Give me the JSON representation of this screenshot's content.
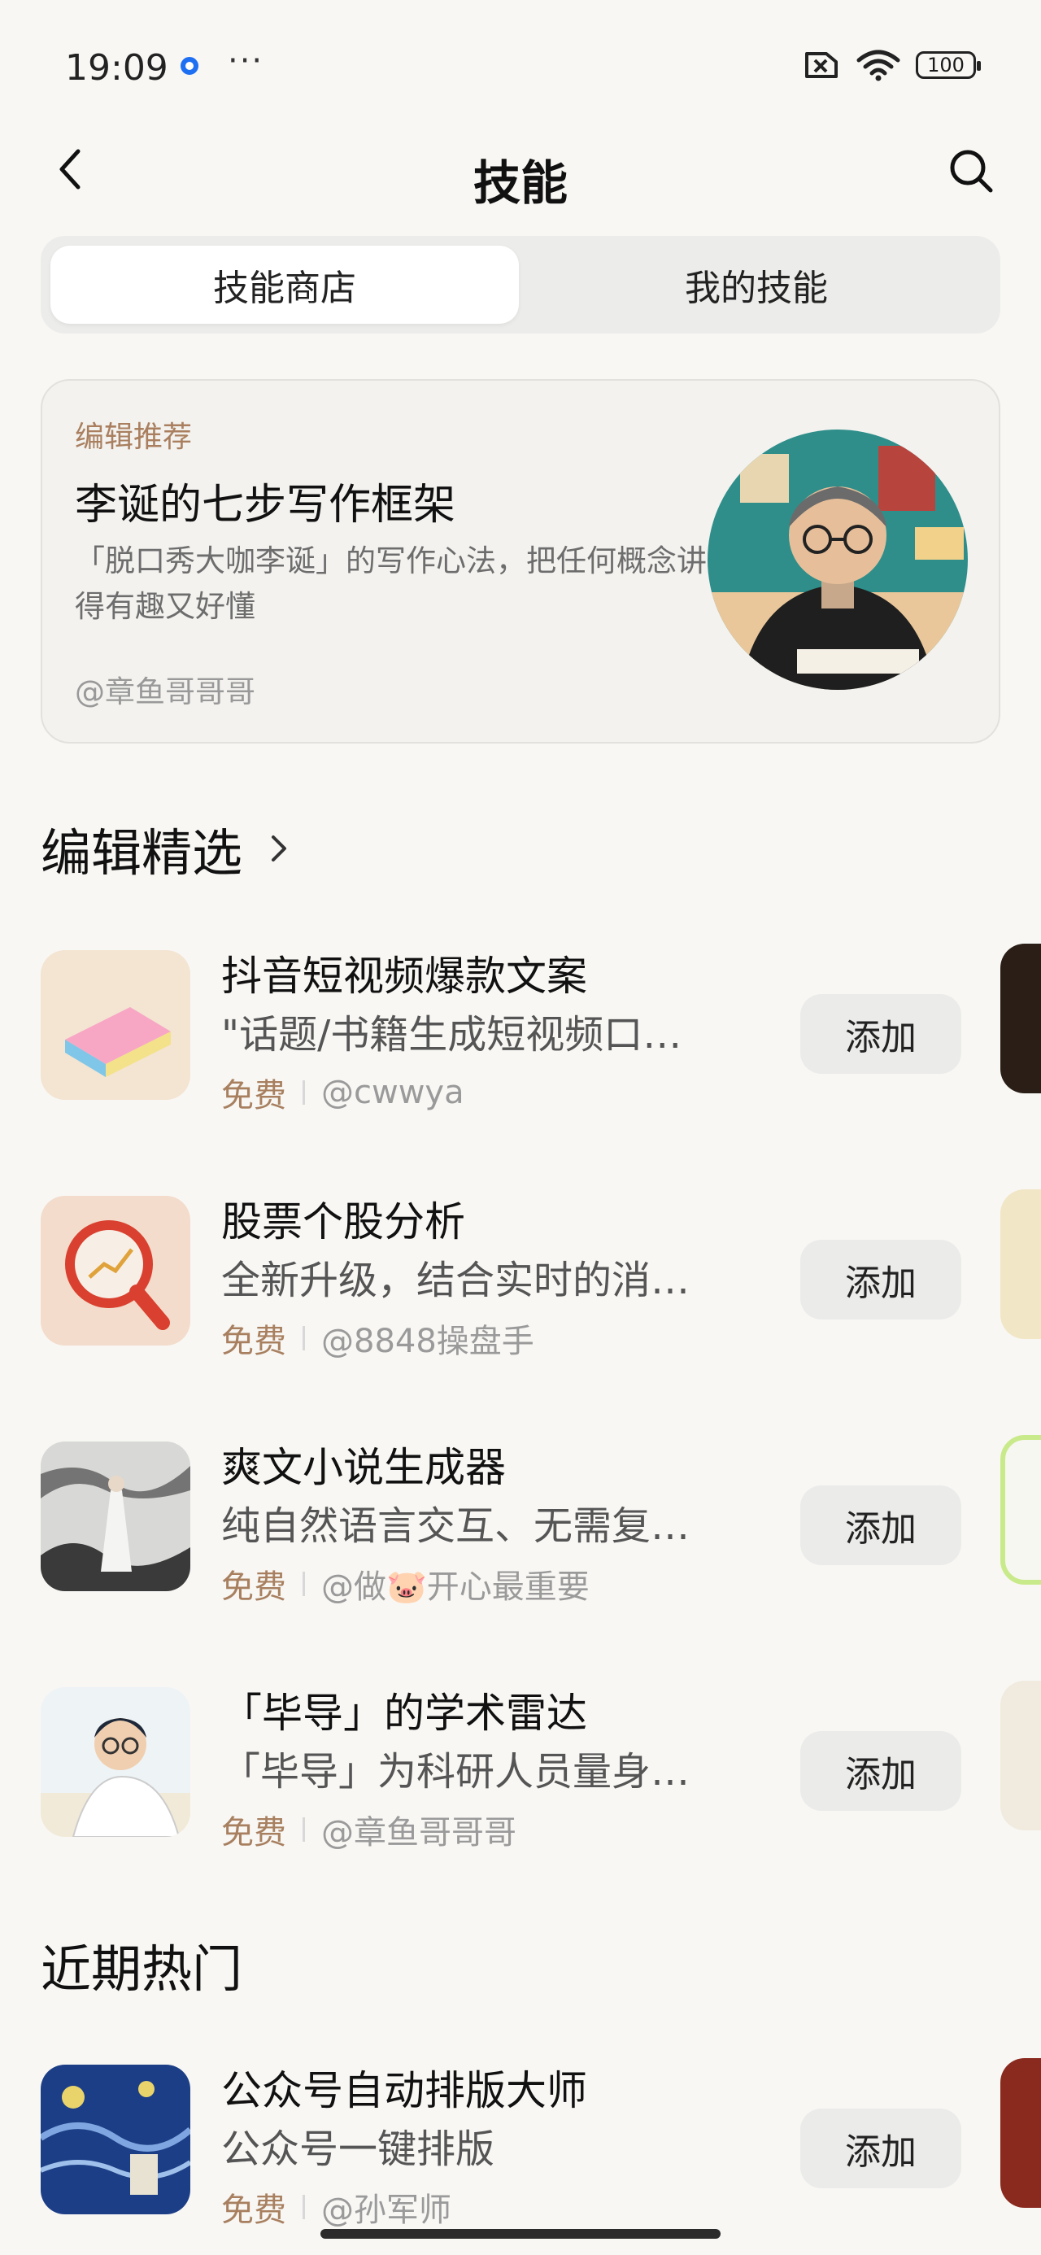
{
  "status_bar": {
    "time": "19:09",
    "battery": "100"
  },
  "header": {
    "title": "技能"
  },
  "tabs": [
    {
      "label": "技能商店",
      "active": true
    },
    {
      "label": "我的技能",
      "active": false
    }
  ],
  "feature": {
    "tag": "编辑推荐",
    "title": "李诞的七步写作框架",
    "description": "「脱口秀大咖李诞」的写作心法，把任何概念讲得有趣又好懂",
    "author": "@章鱼哥哥哥"
  },
  "sections": [
    {
      "title": "编辑精选",
      "items": [
        {
          "name": "抖音短视频爆款文案",
          "desc": "\"话题/书籍生成短视频口…",
          "free": "免费",
          "author": "@cwwya",
          "add": "添加",
          "thumb_icon": "book-icon"
        },
        {
          "name": "股票个股分析",
          "desc": "全新升级，结合实时的消…",
          "free": "免费",
          "author": "@8848操盘手",
          "add": "添加",
          "thumb_icon": "magnifier-chart-icon"
        },
        {
          "name": "爽文小说生成器",
          "desc": "纯自然语言交互、无需复…",
          "free": "免费",
          "author": "@做🐷开心最重要",
          "add": "添加",
          "thumb_icon": "ink-painting-icon"
        },
        {
          "name": "「毕导」的学术雷达",
          "desc": "「毕导」为科研人员量身…",
          "free": "免费",
          "author": "@章鱼哥哥哥",
          "add": "添加",
          "thumb_icon": "scholar-icon"
        }
      ]
    },
    {
      "title": "近期热门",
      "items": [
        {
          "name": "公众号自动排版大师",
          "desc": "公众号一键排版",
          "free": "免费",
          "author": "@孙军师",
          "add": "添加",
          "thumb_icon": "starry-night-icon"
        }
      ]
    }
  ]
}
